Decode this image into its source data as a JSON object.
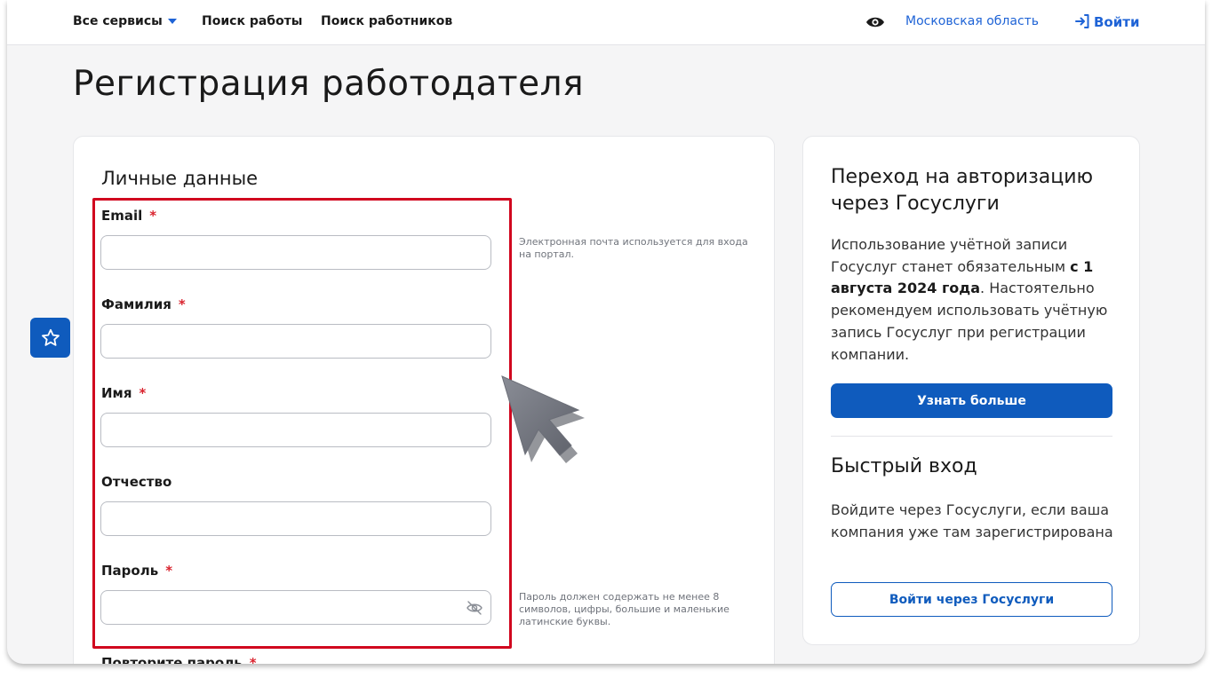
{
  "header": {
    "all_services": "Все сервисы",
    "job_search": "Поиск работы",
    "worker_search": "Поиск работников",
    "eye_icon": "eye-icon",
    "region": "Московская область",
    "login": "Войти",
    "accent": "#1e63d6"
  },
  "page": {
    "title": "Регистрация работодателя"
  },
  "form": {
    "section_title": "Личные данные",
    "required_mark": "*",
    "fields": {
      "email": {
        "label": "Email",
        "value": "",
        "hint": "Электронная почта используется для входа на портал."
      },
      "last_name": {
        "label": "Фамилия",
        "value": ""
      },
      "first_name": {
        "label": "Имя",
        "value": ""
      },
      "middle_name": {
        "label": "Отчество",
        "value": ""
      },
      "password": {
        "label": "Пароль",
        "value": "",
        "hint": "Пароль должен содержать не менее 8 символов, цифры, большие и маленькие латинские буквы."
      },
      "repeat_password": {
        "label": "Повторите пароль"
      }
    },
    "highlight_color": "#d1071f"
  },
  "sidebar": {
    "gosuslugi_title": "Переход на авторизацию через Госуслуги",
    "gosuslugi_text_before": "Использование учётной записи Госуслуг станет обязательным ",
    "gosuslugi_text_bold": "с 1 августа 2024 года",
    "gosuslugi_text_after": ". Настоятельно рекомендуем использовать учётную запись Госуслуг при регистрации компании.",
    "learn_more": "Узнать больше",
    "quick_title": "Быстрый вход",
    "quick_text": "Войдите через Госуслуги, если ваша компания уже там зарегистрирована",
    "login_gosuslugi": "Войти через Госуслуги",
    "button_color": "#0f5bbd"
  },
  "floating": {
    "favorite_icon": "star-icon"
  }
}
